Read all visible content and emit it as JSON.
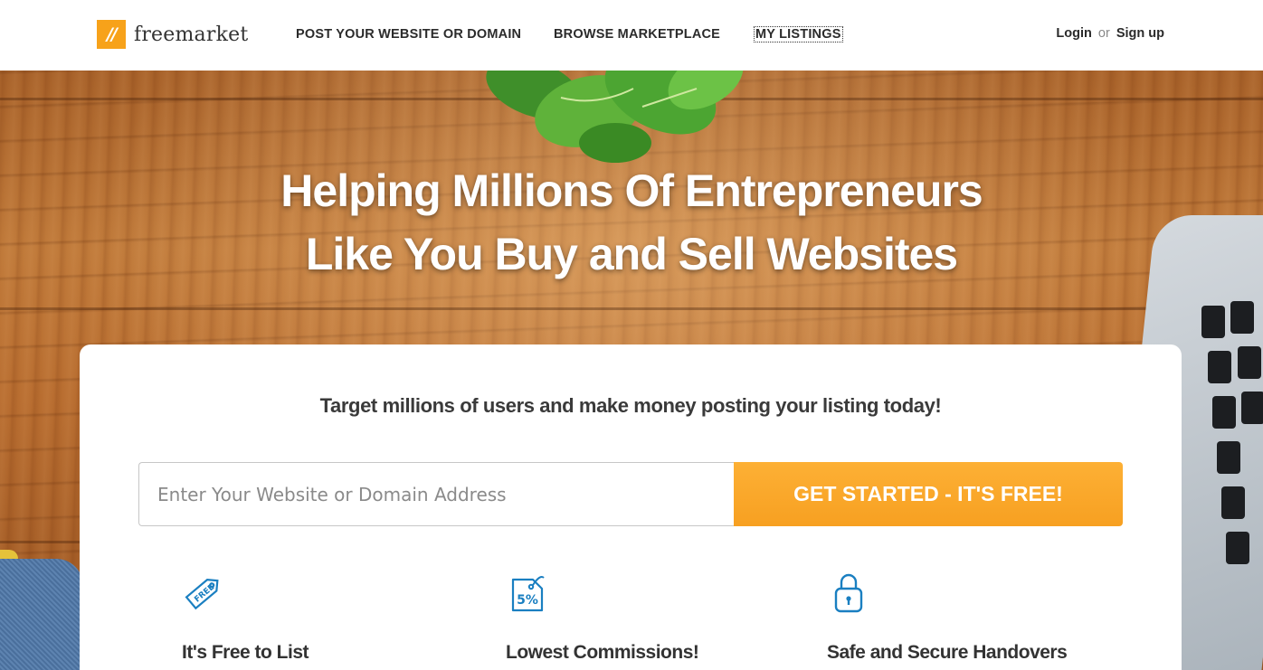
{
  "header": {
    "logo_mark": "//",
    "logo_text": "freemarket",
    "nav": {
      "post": "POST YOUR WEBSITE OR DOMAIN",
      "browse": "BROWSE MARKETPLACE",
      "my_listings": "MY LISTINGS"
    },
    "auth": {
      "login": "Login",
      "or": "or",
      "signup": "Sign up"
    }
  },
  "hero": {
    "headline_line1": "Helping Millions Of Entrepreneurs",
    "headline_line2": "Like You Buy and Sell Websites"
  },
  "card": {
    "tagline": "Target millions of users and make money posting your listing today!",
    "input_placeholder": "Enter Your Website or Domain Address",
    "cta_label": "GET STARTED - IT'S FREE!",
    "features": [
      {
        "title": "It's Free to List",
        "icon": "free-tag-icon"
      },
      {
        "title": "Lowest Commissions!",
        "icon": "percent-tag-icon"
      },
      {
        "title": "Safe and Secure Handovers",
        "icon": "lock-icon"
      }
    ]
  },
  "colors": {
    "accent": "#f7a21a",
    "icon_blue": "#1a7fc1",
    "text_dark": "#2b2b2b"
  }
}
